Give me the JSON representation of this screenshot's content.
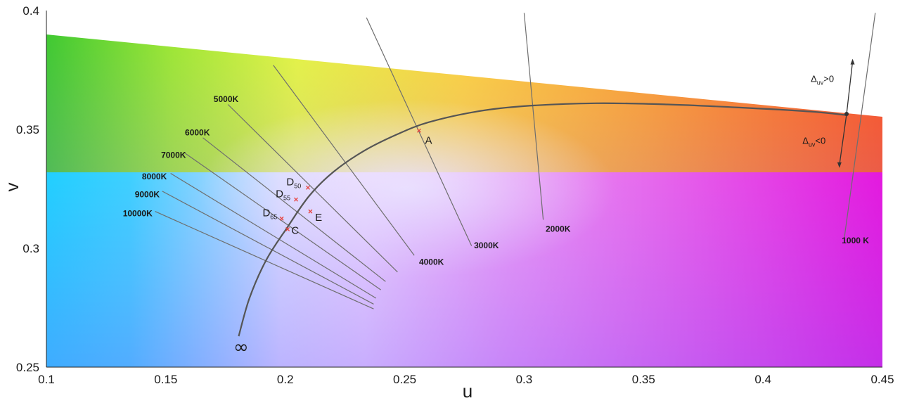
{
  "chart_data": {
    "type": "scatter",
    "xlabel": "u",
    "ylabel": "v",
    "xlim": [
      0.1,
      0.45
    ],
    "ylim": [
      0.25,
      0.4
    ],
    "xticks": [
      "0.1",
      "0.15",
      "0.2",
      "0.25",
      "0.3",
      "0.35",
      "0.4",
      "0.45"
    ],
    "yticks": [
      "0.25",
      "0.3",
      "0.35",
      "0.4"
    ],
    "grid": false,
    "background": "CIE 1960 uv chromaticity gamut colour fill",
    "locus": {
      "name": "Planckian locus",
      "color": "#555555",
      "points": [
        [
          0.1805,
          0.263
        ],
        [
          0.185,
          0.279
        ],
        [
          0.192,
          0.295
        ],
        [
          0.201,
          0.309
        ],
        [
          0.21,
          0.322
        ],
        [
          0.22,
          0.332
        ],
        [
          0.233,
          0.341
        ],
        [
          0.247,
          0.348
        ],
        [
          0.26,
          0.353
        ],
        [
          0.28,
          0.3575
        ],
        [
          0.3,
          0.3598
        ],
        [
          0.33,
          0.361
        ],
        [
          0.36,
          0.3605
        ],
        [
          0.39,
          0.3592
        ],
        [
          0.42,
          0.3575
        ],
        [
          0.435,
          0.356
        ]
      ],
      "infinity_label": "∞",
      "infinity_at": [
        0.1815,
        0.2595
      ]
    },
    "isotherms": [
      {
        "label": "10000K",
        "start": [
          0.1455,
          0.3155
        ],
        "end": [
          0.237,
          0.2745
        ],
        "label_at": [
          0.132,
          0.3135
        ]
      },
      {
        "label": "9000K",
        "start": [
          0.1485,
          0.324
        ],
        "end": [
          0.237,
          0.2765
        ],
        "label_at": [
          0.137,
          0.3215
        ]
      },
      {
        "label": "8000K",
        "start": [
          0.152,
          0.3315
        ],
        "end": [
          0.238,
          0.279
        ],
        "label_at": [
          0.14,
          0.329
        ]
      },
      {
        "label": "7000K",
        "start": [
          0.158,
          0.34
        ],
        "end": [
          0.24,
          0.2825
        ],
        "label_at": [
          0.148,
          0.338
        ]
      },
      {
        "label": "6000K",
        "start": [
          0.1655,
          0.3465
        ],
        "end": [
          0.242,
          0.286
        ],
        "label_at": [
          0.158,
          0.3475
        ]
      },
      {
        "label": "5000K",
        "start": [
          0.176,
          0.3605
        ],
        "end": [
          0.247,
          0.29
        ],
        "label_at": [
          0.17,
          0.3615
        ]
      },
      {
        "label": "4000K",
        "start": [
          0.195,
          0.377
        ],
        "end": [
          0.254,
          0.297
        ],
        "label_at": [
          0.256,
          0.293
        ]
      },
      {
        "label": "3000K",
        "start": [
          0.234,
          0.397
        ],
        "end": [
          0.278,
          0.301
        ],
        "label_at": [
          0.279,
          0.3
        ]
      },
      {
        "label": "2000K",
        "start": [
          0.3,
          0.399
        ],
        "end": [
          0.308,
          0.312
        ],
        "label_at": [
          0.309,
          0.307
        ]
      },
      {
        "label": "1000 K",
        "start": [
          0.447,
          0.399
        ],
        "end": [
          0.434,
          0.304
        ],
        "label_at": [
          0.433,
          0.302
        ]
      }
    ],
    "points": [
      {
        "label": "A",
        "sub": "",
        "u": 0.256,
        "v": 0.3495,
        "label_at": [
          0.2585,
          0.344
        ],
        "color": "#e8413c"
      },
      {
        "label": "D",
        "sub": "50",
        "u": 0.2095,
        "v": 0.3255,
        "label_at": [
          0.2005,
          0.3265
        ],
        "color": "#e8413c"
      },
      {
        "label": "D",
        "sub": "55",
        "u": 0.2045,
        "v": 0.3205,
        "label_at": [
          0.196,
          0.3215
        ],
        "color": "#e8413c"
      },
      {
        "label": "E",
        "sub": "",
        "u": 0.2105,
        "v": 0.3155,
        "label_at": [
          0.2125,
          0.3115
        ],
        "color": "#e8413c"
      },
      {
        "label": "D",
        "sub": "65",
        "u": 0.1985,
        "v": 0.3125,
        "label_at": [
          0.1905,
          0.3135
        ],
        "color": "#e8413c"
      },
      {
        "label": "C",
        "sub": "",
        "u": 0.201,
        "v": 0.308,
        "label_at": [
          0.2025,
          0.306
        ],
        "color": "#e8413c"
      }
    ],
    "annotations": [
      {
        "label": "Δ",
        "sub": "uv",
        "suffix": ">0",
        "label_at": [
          0.42,
          0.37
        ]
      },
      {
        "label": "Δ",
        "sub": "uv",
        "suffix": "<0",
        "label_at": [
          0.4165,
          0.344
        ]
      }
    ],
    "delta_arrows": {
      "origin": [
        0.435,
        0.3565
      ],
      "up_to": [
        0.4375,
        0.3785
      ],
      "down_to": [
        0.432,
        0.335
      ]
    }
  }
}
